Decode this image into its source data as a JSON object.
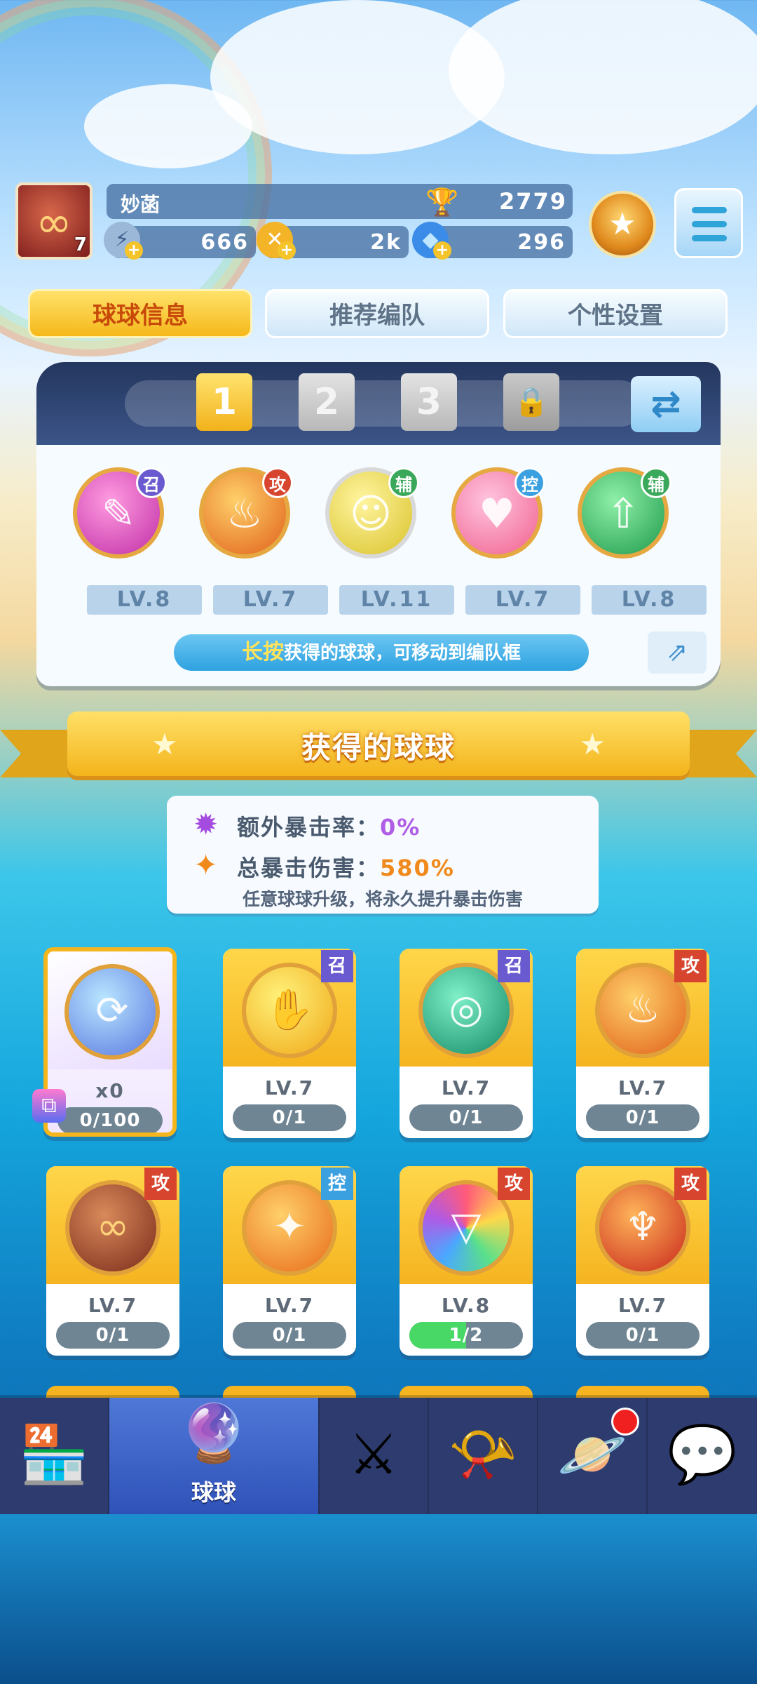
{
  "player": {
    "name": "妙菡",
    "level": "7",
    "trophies": "2779",
    "stamina": "666",
    "gold": "2k",
    "gems": "296"
  },
  "tabs": [
    {
      "label": "球球信息",
      "active": true
    },
    {
      "label": "推荐编队",
      "active": false
    },
    {
      "label": "个性设置",
      "active": false
    }
  ],
  "team": {
    "slots": [
      "1",
      "2",
      "3"
    ],
    "active_slot": "1",
    "balls": [
      {
        "tag": "召",
        "level": "LV.8"
      },
      {
        "tag": "攻",
        "level": "LV.7"
      },
      {
        "tag": "辅",
        "level": "LV.11"
      },
      {
        "tag": "控",
        "level": "LV.7"
      },
      {
        "tag": "辅",
        "level": "LV.8"
      }
    ],
    "hint_highlight": "长按",
    "hint_text": "获得的球球，可移动到编队框"
  },
  "section_title": "获得的球球",
  "stats": {
    "crit_rate_label": "额外暴击率：",
    "crit_rate_value": "0%",
    "crit_damage_label": "总暴击伤害：",
    "crit_damage_value": "580%",
    "note": "任意球球升级，将永久提升暴击伤害"
  },
  "cards": [
    {
      "tag": "",
      "level": "x0",
      "progress": "0/100",
      "fill": 0
    },
    {
      "tag": "召",
      "level": "LV.7",
      "progress": "0/1",
      "fill": 0
    },
    {
      "tag": "召",
      "level": "LV.7",
      "progress": "0/1",
      "fill": 0
    },
    {
      "tag": "攻",
      "level": "LV.7",
      "progress": "0/1",
      "fill": 0
    },
    {
      "tag": "攻",
      "level": "LV.7",
      "progress": "0/1",
      "fill": 0
    },
    {
      "tag": "控",
      "level": "LV.7",
      "progress": "0/1",
      "fill": 0
    },
    {
      "tag": "攻",
      "level": "LV.8",
      "progress": "1/2",
      "fill": 0.5
    },
    {
      "tag": "攻",
      "level": "LV.7",
      "progress": "0/1",
      "fill": 0
    }
  ],
  "nav": {
    "active_label": "球球"
  },
  "colors": {
    "accent_yellow": "#f5b81a",
    "nav_bg": "#2d3b6e",
    "nav_active": "#3f66cc",
    "progress_fill": "#47d866"
  }
}
